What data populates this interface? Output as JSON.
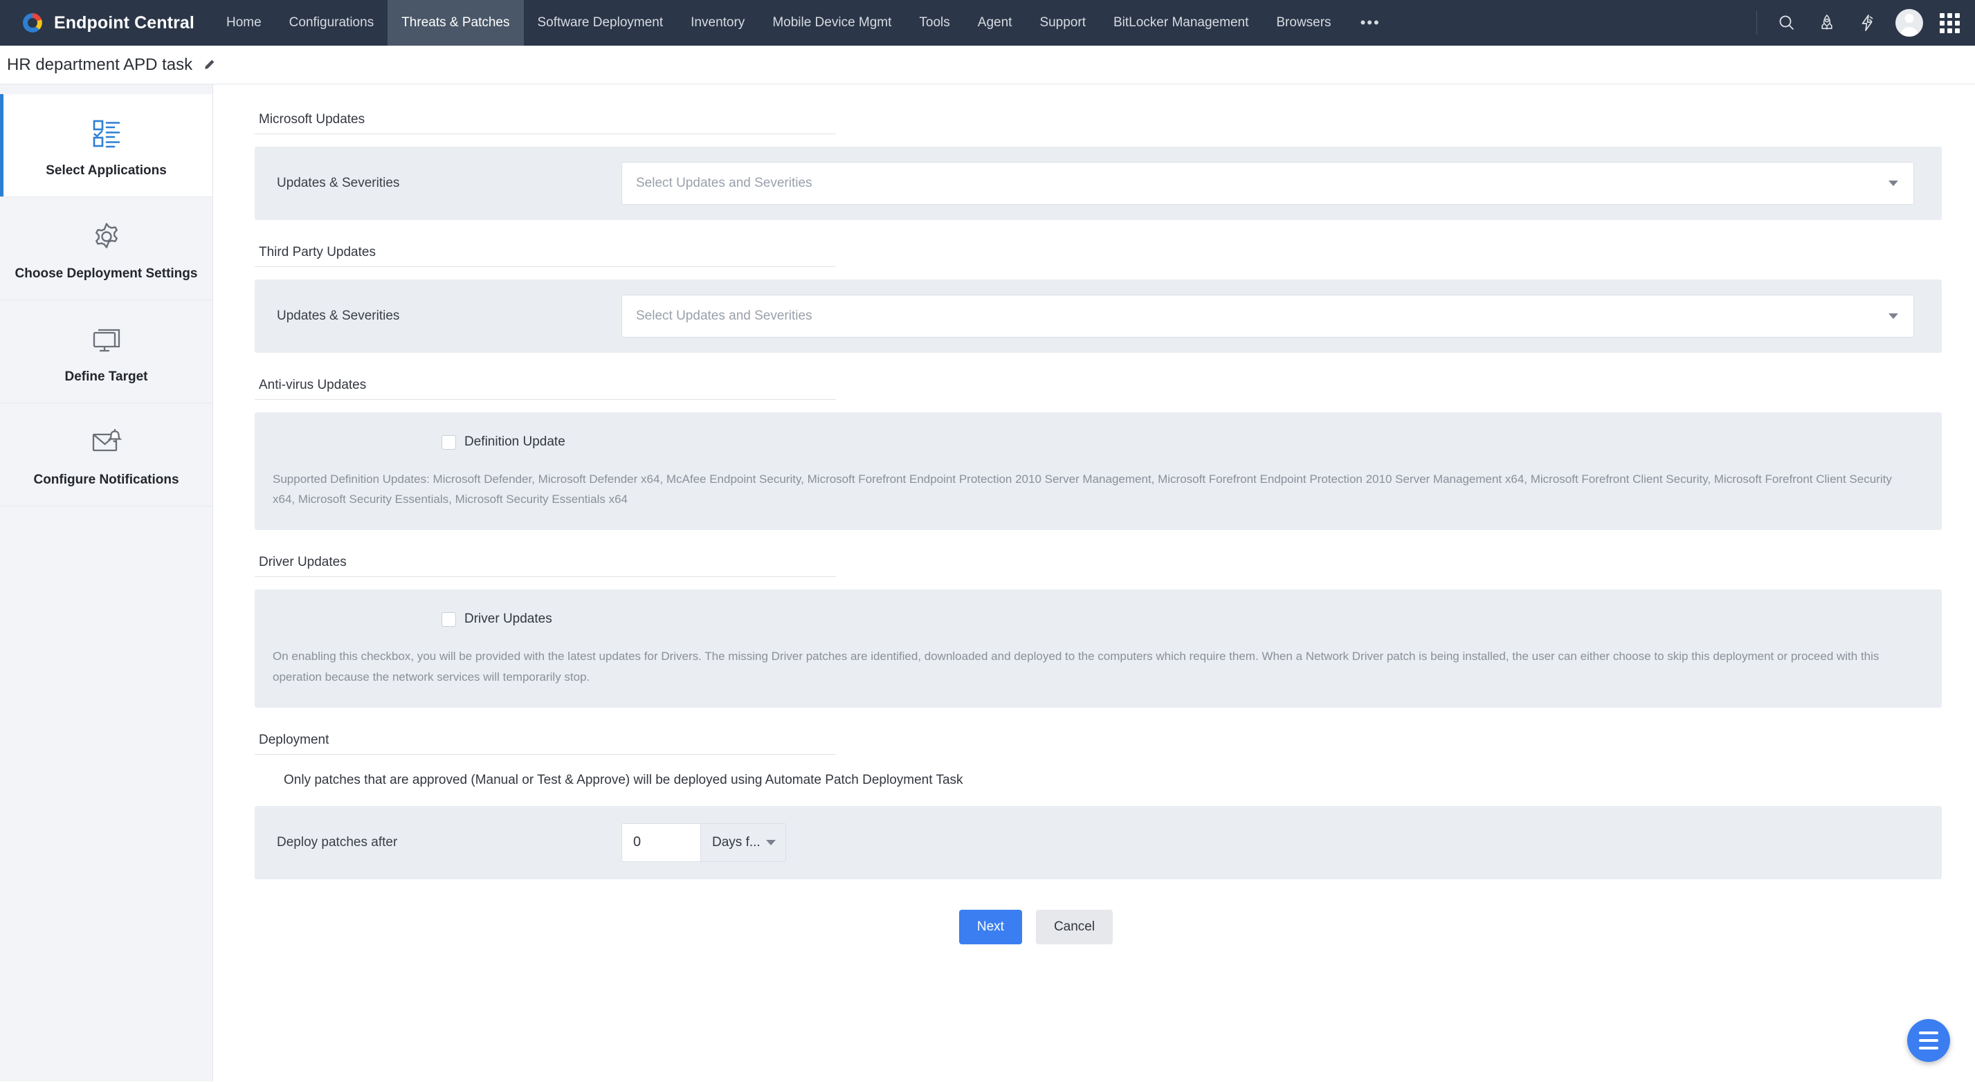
{
  "app": {
    "brand": "Endpoint Central",
    "logo_icon": "endpoint-central-logo-icon"
  },
  "topnav": {
    "items": [
      {
        "label": "Home",
        "active": false
      },
      {
        "label": "Configurations",
        "active": false
      },
      {
        "label": "Threats & Patches",
        "active": true
      },
      {
        "label": "Software Deployment",
        "active": false
      },
      {
        "label": "Inventory",
        "active": false
      },
      {
        "label": "Mobile Device Mgmt",
        "active": false
      },
      {
        "label": "Tools",
        "active": false
      },
      {
        "label": "Agent",
        "active": false
      },
      {
        "label": "Support",
        "active": false
      },
      {
        "label": "BitLocker Management",
        "active": false
      },
      {
        "label": "Browsers",
        "active": false
      }
    ],
    "more_label": "•••",
    "right_icons": [
      "search-icon",
      "rocket-icon",
      "lightning-bolt-icon",
      "avatar",
      "app-grid-icon"
    ]
  },
  "page": {
    "title": "HR department APD task",
    "edit_icon": "pencil-edit-icon"
  },
  "sidebar": {
    "items": [
      {
        "label": "Select Applications",
        "icon": "checklist-icon",
        "active": true
      },
      {
        "label": "Choose Deployment Settings",
        "icon": "gear-icon",
        "active": false
      },
      {
        "label": "Define Target",
        "icon": "monitor-icon",
        "active": false
      },
      {
        "label": "Configure Notifications",
        "icon": "mail-bell-icon",
        "active": false
      }
    ]
  },
  "main": {
    "microsoft_updates": {
      "heading": "Microsoft Updates",
      "field_label": "Updates & Severities",
      "select_placeholder": "Select Updates and Severities",
      "select_value": ""
    },
    "third_party_updates": {
      "heading": "Third Party Updates",
      "field_label": "Updates & Severities",
      "select_placeholder": "Select Updates and Severities",
      "select_value": ""
    },
    "antivirus_updates": {
      "heading": "Anti-virus Updates",
      "checkbox_label": "Definition Update",
      "checked": false,
      "note": "Supported Definition Updates: Microsoft Defender, Microsoft Defender x64, McAfee Endpoint Security, Microsoft Forefront Endpoint Protection 2010 Server Management, Microsoft Forefront Endpoint Protection 2010 Server Management x64, Microsoft Forefront Client Security, Microsoft Forefront Client Security x64, Microsoft Security Essentials, Microsoft Security Essentials x64"
    },
    "driver_updates": {
      "heading": "Driver Updates",
      "checkbox_label": "Driver Updates",
      "checked": false,
      "note": "On enabling this checkbox, you will be provided with the latest updates for Drivers. The missing Driver patches are identified, downloaded and deployed to the computers which require them. When a Network Driver patch is being installed, the user can either choose to skip this deployment or proceed with this operation because the network services will temporarily stop."
    },
    "deployment": {
      "heading": "Deployment",
      "note": "Only patches that are approved (Manual or Test & Approve) will be deployed using Automate Patch Deployment Task",
      "field_label": "Deploy patches after",
      "days_value": "0",
      "unit_value": "Days f...",
      "unit_options": [
        "Days f..."
      ]
    },
    "footer": {
      "next_label": "Next",
      "cancel_label": "Cancel"
    },
    "fab_icon": "menu-hamburger-icon"
  },
  "colors": {
    "topbar_bg": "#2b3648",
    "accent": "#3b7ef1",
    "active_step": "#2d7fd3",
    "panel_bg": "#eaedf2",
    "sidebar_bg": "#f2f4f7"
  }
}
